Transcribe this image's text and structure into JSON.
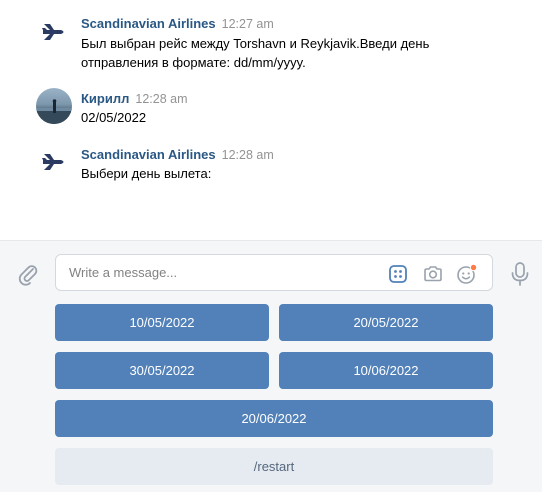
{
  "messages": [
    {
      "author": "Scandinavian Airlines",
      "time": "12:27 am",
      "avatar": "airplane-logo",
      "lines": [
        "Был выбран рейс между Torshavn и Reykjavik.Введи день",
        "отправления в формате: dd/mm/yyyy."
      ]
    },
    {
      "author": "Кирилл",
      "time": "12:28 am",
      "avatar": "user-photo",
      "lines": [
        "02/05/2022"
      ]
    },
    {
      "author": "Scandinavian Airlines",
      "time": "12:28 am",
      "avatar": "airplane-logo",
      "lines": [
        "Выбери день вылета:"
      ]
    }
  ],
  "composer": {
    "placeholder": "Write a message...",
    "icons": [
      "paperclip-icon",
      "keyboard-grid-icon",
      "camera-icon",
      "emoji-icon",
      "microphone-icon"
    ]
  },
  "keyboard": {
    "buttons": [
      "10/05/2022",
      "20/05/2022",
      "30/05/2022",
      "10/06/2022",
      "20/06/2022"
    ],
    "secondary_button": "/restart"
  },
  "colors": {
    "author": "#2a5885",
    "button_primary": "#5181b8",
    "button_secondary": "#e5ebf1",
    "composer_bg": "#f5f6f8",
    "notification_dot": "#ff7a45"
  }
}
